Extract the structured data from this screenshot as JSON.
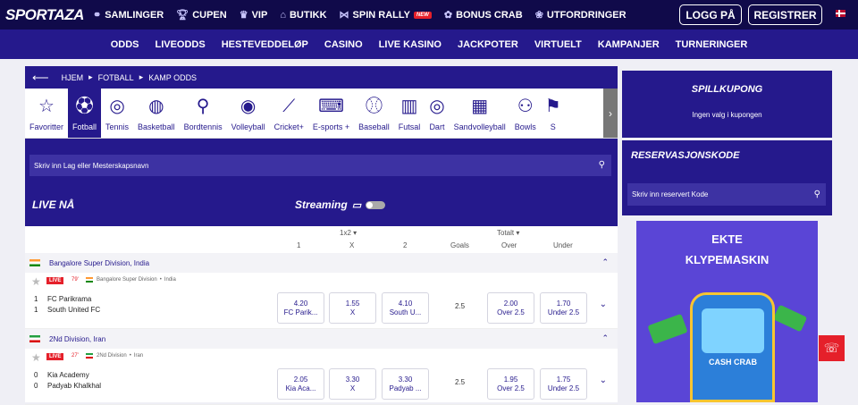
{
  "header": {
    "logo": "SPORTAZA",
    "nav": [
      {
        "icon": "rings-icon",
        "glyph": "⚭",
        "label": "SAMLINGER"
      },
      {
        "icon": "trophy-icon",
        "glyph": "🏆︎",
        "label": "CUPEN"
      },
      {
        "icon": "crown-icon",
        "glyph": "♛",
        "label": "VIP"
      },
      {
        "icon": "basket-icon",
        "glyph": "⌂",
        "label": "BUTIKK"
      },
      {
        "icon": "wings-icon",
        "glyph": "⋈",
        "label": "SPIN RALLY",
        "badge": "NEW"
      },
      {
        "icon": "crab-icon",
        "glyph": "✿",
        "label": "BONUS CRAB"
      },
      {
        "icon": "medal-icon",
        "glyph": "❀",
        "label": "UTFORDRINGER"
      }
    ],
    "login": "LOGG PÅ",
    "register": "REGISTRER"
  },
  "subnav": [
    "ODDS",
    "LIVEODDS",
    "HESTEVEDDELØP",
    "CASINO",
    "LIVE KASINO",
    "JACKPOTER",
    "VIRTUELT",
    "KAMPANJER",
    "TURNERINGER"
  ],
  "breadcrumb": [
    "HJEM",
    "FOTBALL",
    "KAMP ODDS"
  ],
  "sports": [
    {
      "icon": "star-icon",
      "glyph": "☆",
      "label": "Favoritter"
    },
    {
      "icon": "football-icon",
      "glyph": "⚽︎",
      "label": "Fotball",
      "active": true
    },
    {
      "icon": "tennis-icon",
      "glyph": "◎",
      "label": "Tennis"
    },
    {
      "icon": "basketball-icon",
      "glyph": "◍",
      "label": "Basketball"
    },
    {
      "icon": "table-tennis-icon",
      "glyph": "⚲",
      "label": "Bordtennis"
    },
    {
      "icon": "volleyball-icon",
      "glyph": "◉",
      "label": "Volleyball"
    },
    {
      "icon": "cricket-icon",
      "glyph": "⟋",
      "label": "Cricket+"
    },
    {
      "icon": "gamepad-icon",
      "glyph": "⌨",
      "label": "E-sports +"
    },
    {
      "icon": "baseball-icon",
      "glyph": "⚾︎",
      "label": "Baseball"
    },
    {
      "icon": "futsal-icon",
      "glyph": "▥",
      "label": "Futsal"
    },
    {
      "icon": "dart-icon",
      "glyph": "◎",
      "label": "Dart"
    },
    {
      "icon": "sandvolleyball-icon",
      "glyph": "▦",
      "label": "Sandvolleyball"
    },
    {
      "icon": "bowls-icon",
      "glyph": "⚇",
      "label": "Bowls"
    },
    {
      "icon": "more-sport-icon",
      "glyph": "⚑",
      "label": "S"
    }
  ],
  "search": {
    "placeholder": "Skriv inn Lag eller Mesterskapsnavn"
  },
  "live": {
    "title": "LIVE NÅ",
    "streaming": "Streaming"
  },
  "columns": {
    "group1": "1x2",
    "group2": "Totalt",
    "one": "1",
    "x": "X",
    "two": "2",
    "goals": "Goals",
    "over": "Over",
    "under": "Under"
  },
  "leagues": [
    {
      "flag": "in",
      "name": "Bangalore Super Division, India",
      "live": "LIVE",
      "minute": "79'",
      "mini_league": "Bangalore Super Division",
      "country": "India",
      "home": {
        "score": "1",
        "name": "FC Parikrama"
      },
      "away": {
        "score": "1",
        "name": "South United FC"
      },
      "odds": [
        {
          "v": "4.20",
          "l": "FC Parik..."
        },
        {
          "v": "1.55",
          "l": "X"
        },
        {
          "v": "4.10",
          "l": "South U..."
        }
      ],
      "goals": "2.5",
      "total": [
        {
          "v": "2.00",
          "l": "Over 2.5"
        },
        {
          "v": "1.70",
          "l": "Under 2.5"
        }
      ]
    },
    {
      "flag": "ir",
      "name": "2Nd Division, Iran",
      "live": "LIVE",
      "minute": "27'",
      "mini_league": "2Nd Division",
      "country": "Iran",
      "home": {
        "score": "0",
        "name": "Kia Academy"
      },
      "away": {
        "score": "0",
        "name": "Padyab Khalkhal"
      },
      "odds": [
        {
          "v": "2.05",
          "l": "Kia Aca..."
        },
        {
          "v": "3.30",
          "l": "X"
        },
        {
          "v": "3.30",
          "l": "Padyab ..."
        }
      ],
      "goals": "2.5",
      "total": [
        {
          "v": "1.95",
          "l": "Over 2.5"
        },
        {
          "v": "1.75",
          "l": "Under 2.5"
        }
      ]
    }
  ],
  "betslip": {
    "title": "SPILLKUPONG",
    "empty": "Ingen valg i kupongen"
  },
  "reservation": {
    "title": "RESERVASJONSKODE",
    "placeholder": "Skriv inn reservert Kode"
  },
  "banner": {
    "line1": "EKTE",
    "line2": "KLYPEMASKIN",
    "brand_text": "CASH CRAB"
  }
}
